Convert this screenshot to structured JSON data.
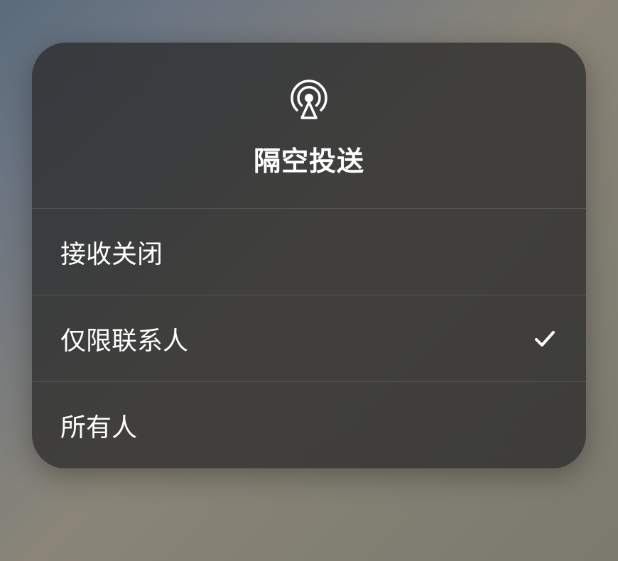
{
  "title": "隔空投送",
  "options": [
    {
      "label": "接收关闭",
      "selected": false
    },
    {
      "label": "仅限联系人",
      "selected": true
    },
    {
      "label": "所有人",
      "selected": false
    }
  ]
}
